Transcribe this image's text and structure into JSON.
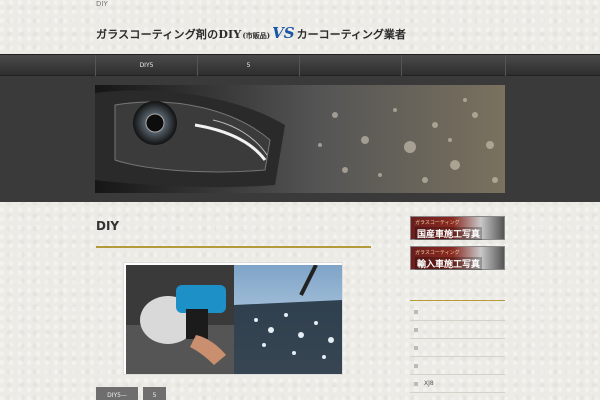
{
  "header": {
    "topline": "DIY",
    "title_part1": "ガラスコーティング剤のDIY",
    "title_part2": "(市販品)",
    "title_vs": "VS",
    "title_part3": "カーコーティング業者"
  },
  "nav": {
    "items": [
      {
        "label": "DIY5"
      },
      {
        "label": "5"
      },
      {
        "label": ""
      },
      {
        "label": ""
      }
    ]
  },
  "hero": {
    "alt": "headlight-and-water-beads-banner"
  },
  "main": {
    "title": "DIY",
    "pager": [
      {
        "label": "DIY5—"
      },
      {
        "label": "5"
      }
    ]
  },
  "sidebar": {
    "banners": [
      {
        "small": "ガラスコーティング",
        "big": "国産車施工写真"
      },
      {
        "small": "ガラスコーティング",
        "big": "輸入車施工写真"
      }
    ],
    "items": [
      {
        "label": ""
      },
      {
        "label": ""
      },
      {
        "label": ""
      },
      {
        "label": ""
      },
      {
        "label": "XJ8"
      }
    ]
  },
  "colors": {
    "accent_gold": "#b59a3a",
    "vs_blue": "#1a56a6",
    "nav_bg": "#3a3a3a"
  }
}
